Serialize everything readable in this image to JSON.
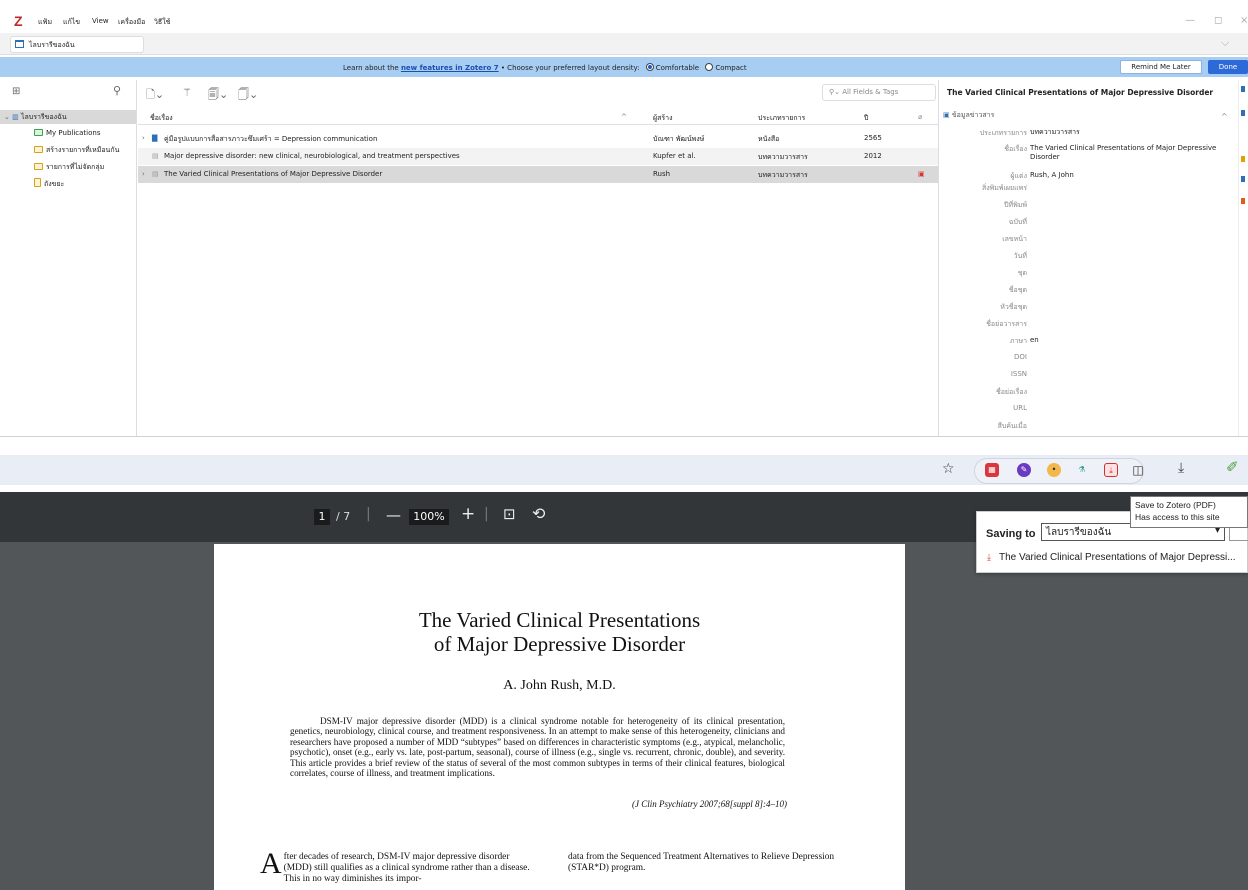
{
  "zotero": {
    "logo": "Z",
    "menu": [
      "แฟ้ม",
      "แก้ไข",
      "View",
      "เครื่องมือ",
      "วิธีใช้"
    ],
    "tab_label": "ไลบรารีของฉัน",
    "notice": {
      "prefix": "Learn about the",
      "link": "new features in Zotero 7",
      "middle": "• Choose your preferred layout density:",
      "opt_comfortable": "Comfortable",
      "opt_compact": "Compact",
      "remind": "Remind Me Later",
      "done": "Done"
    },
    "collections": [
      {
        "label": "ไลบรารีของฉัน",
        "selected": true
      },
      {
        "label": "My Publications"
      },
      {
        "label": "สร้างรายการที่เหมือนกัน"
      },
      {
        "label": "รายการที่ไม่จัดกลุ่ม"
      },
      {
        "label": "ถังขยะ"
      }
    ],
    "search_placeholder": "All Fields & Tags",
    "columns": {
      "title": "ชื่อเรื่อง",
      "creator": "ผู้สร้าง",
      "type": "ประเภทรายการ",
      "year": "ปี"
    },
    "items": [
      {
        "title": "คู่มือรูปแบบการสื่อสารภาวะซึมเศร้า = Depression communication",
        "creator": "บัณฑา พัฒน์พงษ์",
        "type": "หนังสือ",
        "year": "2565"
      },
      {
        "title": "Major depressive disorder: new clinical, neurobiological, and treatment perspectives",
        "creator": "Kupfer et al.",
        "type": "บทความวารสาร",
        "year": "2012"
      },
      {
        "title": "The Varied Clinical Presentations of Major Depressive Disorder",
        "creator": "Rush",
        "type": "บทความวารสาร",
        "year": ""
      }
    ],
    "info": {
      "header": "The Varied Clinical Presentations of Major Depressive Disorder",
      "section": "ข้อมูลข่าวสาร",
      "fields": [
        {
          "label": "ประเภทรายการ",
          "value": "บทความวารสาร"
        },
        {
          "label": "ชื่อเรื่อง",
          "value": "The Varied Clinical Presentations of Major Depressive Disorder"
        },
        {
          "label": "ผู้แต่ง",
          "value": "Rush, A John"
        },
        {
          "label": "สิ่งพิมพ์เผยแพร่",
          "value": ""
        },
        {
          "label": "ปีที่พิมพ์",
          "value": ""
        },
        {
          "label": "ฉบับที่",
          "value": ""
        },
        {
          "label": "เลขหน้า",
          "value": ""
        },
        {
          "label": "วันที่",
          "value": ""
        },
        {
          "label": "ชุด",
          "value": ""
        },
        {
          "label": "ชื่อชุด",
          "value": ""
        },
        {
          "label": "หัวชื่อชุด",
          "value": ""
        },
        {
          "label": "ชื่อย่อวารสาร",
          "value": ""
        },
        {
          "label": "ภาษา",
          "value": "en"
        },
        {
          "label": "DOI",
          "value": ""
        },
        {
          "label": "ISSN",
          "value": ""
        },
        {
          "label": "ชื่อย่อเรื่อง",
          "value": ""
        },
        {
          "label": "URL",
          "value": ""
        },
        {
          "label": "สืบค้นเมื่อ",
          "value": ""
        }
      ]
    }
  },
  "browser": {
    "pdf": {
      "page": "1",
      "total": "/ 7",
      "zoom": "100%"
    },
    "tooltip": {
      "line1": "Save to Zotero (PDF)",
      "line2": "Has access to this site"
    },
    "saving": {
      "label": "Saving to",
      "target": "ไลบรารีของฉัน",
      "item": "The Varied Clinical Presentations of Major Depressi..."
    },
    "doc": {
      "title1": "The Varied Clinical Presentations",
      "title2": "of Major Depressive Disorder",
      "author": "A. John Rush, M.D.",
      "abstract": "DSM-IV major depressive disorder (MDD) is a clinical syndrome notable for heterogeneity of its clinical presentation, genetics, neurobiology, clinical course, and treatment responsiveness. In an attempt to make sense of this heterogeneity, clinicians and researchers have proposed a number of MDD “subtypes” based on differences in characteristic symptoms (e.g., atypical, melancholic, psychotic), onset (e.g., early vs. late, post-partum, seasonal), course of illness (e.g., single vs. recurrent, chronic, double), and severity. This article provides a brief review of the status of several of the most common subtypes in terms of their clinical features, biological correlates, course of illness, and treatment implications.",
      "citation": "(J Clin Psychiatry 2007;68[suppl 8]:4–10)",
      "dropcap": "A",
      "colA": "fter decades of research, DSM-IV major depressive disorder (MDD) still qualifies as a clinical syndrome rather than a disease. This in no way diminishes its impor-",
      "colB": "data from the Sequenced Treatment Alternatives to Relieve Depression (STAR*D) program."
    }
  }
}
